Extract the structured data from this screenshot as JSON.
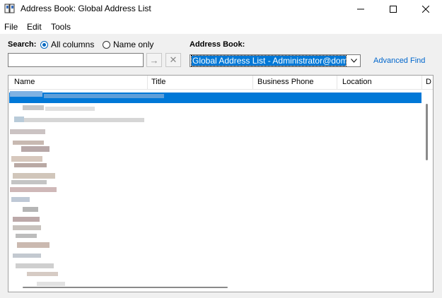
{
  "window": {
    "title": "Address Book: Global Address List"
  },
  "menu": {
    "file": "File",
    "edit": "Edit",
    "tools": "Tools"
  },
  "search": {
    "label": "Search:",
    "option_all": "All columns",
    "option_name": "Name only",
    "selected": "All columns",
    "value": "",
    "go_icon": "arrow-right-icon",
    "clear_icon": "close-icon"
  },
  "address_book": {
    "label": "Address Book:",
    "selected": "Global Address List - Administrator@doma"
  },
  "advanced_find": "Advanced Find",
  "columns": [
    "Name",
    "Title",
    "Business Phone",
    "Location",
    "D"
  ],
  "colors": {
    "accent": "#0078d7",
    "link": "#0066cc"
  }
}
